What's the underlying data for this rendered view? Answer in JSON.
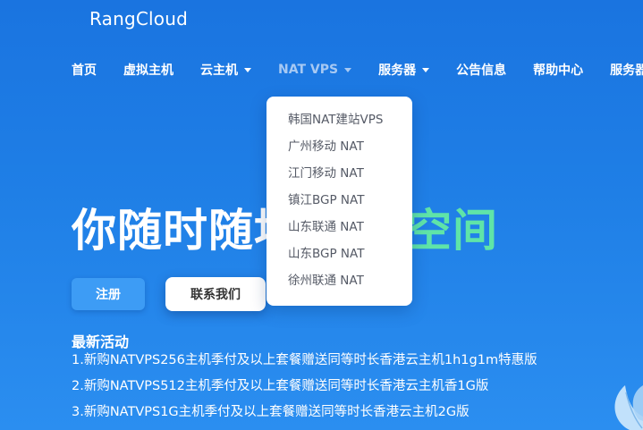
{
  "brand": "RangCloud",
  "nav": [
    {
      "label": "首页",
      "caret": false,
      "active": false
    },
    {
      "label": "虚拟主机",
      "caret": false,
      "active": false
    },
    {
      "label": "云主机",
      "caret": true,
      "active": false
    },
    {
      "label": "NAT VPS",
      "caret": true,
      "active": true
    },
    {
      "label": "服务器",
      "caret": true,
      "active": false
    },
    {
      "label": "公告信息",
      "caret": false,
      "active": false
    },
    {
      "label": "帮助中心",
      "caret": false,
      "active": false
    },
    {
      "label": "服务器",
      "caret": false,
      "active": false
    }
  ],
  "dropdown": {
    "items": [
      "韩国NAT建站VPS",
      "广州移动 NAT",
      "江门移动 NAT",
      "镇江BGP NAT",
      "山东联通 NAT",
      "山东BGP NAT",
      "徐州联通 NAT"
    ]
  },
  "hero": {
    "title_main": "你随时随地",
    "title_highlight": "空间",
    "highlight_color": "#5fe4a8"
  },
  "buttons": {
    "register": "注册",
    "contact": "联系我们"
  },
  "news": {
    "title": "最新活动",
    "items": [
      "1.新购NATVPS256主机季付及以上套餐赠送同等时长香港云主机1h1g1m特惠版",
      "2.新购NATVPS512主机季付及以上套餐赠送同等时长香港云主机香1G版",
      "3.新购NATVPS1G主机季付及以上套餐赠送同等时长香港云主机2G版"
    ]
  },
  "colors": {
    "background": "#1f7fe6",
    "active_nav": "#a7c9f3",
    "register_button": "#3d9cf5"
  }
}
